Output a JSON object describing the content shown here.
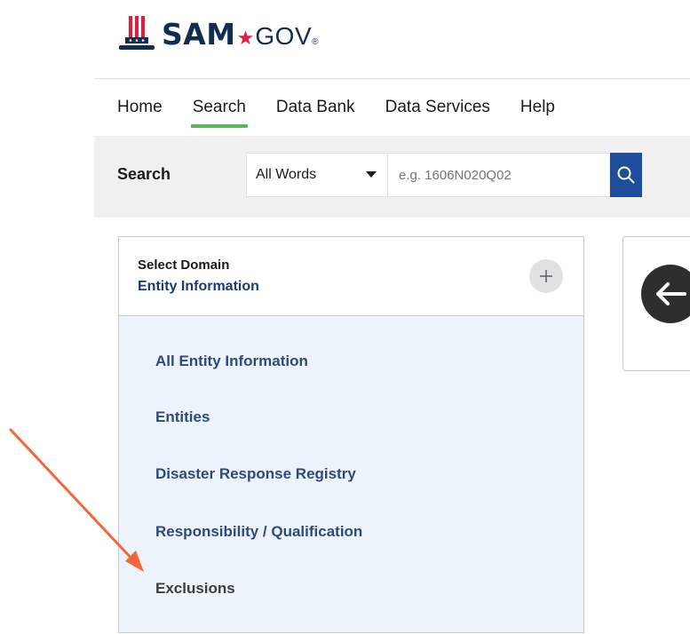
{
  "brand": {
    "sam": "SAM",
    "gov": "GOV",
    "reg": "®",
    "colors": {
      "navy": "#112e51",
      "red": "#e31c3d"
    }
  },
  "nav": {
    "items": [
      {
        "label": "Home",
        "active": false
      },
      {
        "label": "Search",
        "active": true
      },
      {
        "label": "Data Bank",
        "active": false
      },
      {
        "label": "Data Services",
        "active": false
      },
      {
        "label": "Help",
        "active": false
      }
    ],
    "active_color": "#5ab55e"
  },
  "search": {
    "label": "Search",
    "mode_value": "All Words",
    "placeholder": "e.g. 1606N020Q02",
    "button_icon": "search-icon",
    "button_color": "#1e4d9a"
  },
  "domain": {
    "select_label": "Select Domain",
    "selected": "Entity Information",
    "toggle_icon": "plus-icon",
    "options": [
      {
        "label": "All Entity Information"
      },
      {
        "label": "Entities"
      },
      {
        "label": "Disaster Response Registry"
      },
      {
        "label": "Responsibility / Qualification"
      },
      {
        "label": "Exclusions"
      }
    ]
  },
  "side_panel": {
    "icon": "arrow-left-icon"
  },
  "annotation": {
    "icon": "pointer-arrow-icon",
    "color": "#f2683b"
  }
}
